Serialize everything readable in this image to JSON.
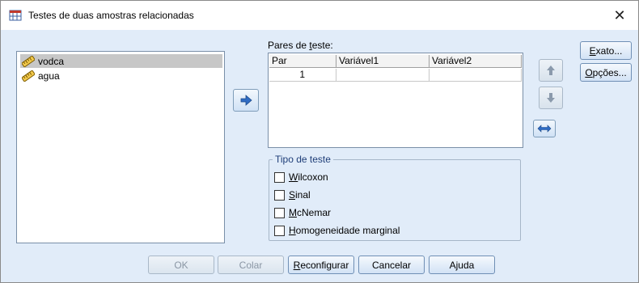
{
  "window": {
    "title": "Testes de duas amostras relacionadas",
    "close_glyph": "✕"
  },
  "variables": [
    {
      "name": "vodca",
      "icon": "scale-ruler-icon",
      "selected": true
    },
    {
      "name": "agua",
      "icon": "scale-ruler-icon",
      "selected": false
    }
  ],
  "pairs": {
    "label_prefix": "Pares de ",
    "label_accel": "t",
    "label_suffix": "este:",
    "columns": [
      "Par",
      "Variável1",
      "Variável2"
    ],
    "rows": [
      {
        "par": "1",
        "var1": "",
        "var2": ""
      }
    ]
  },
  "test_type": {
    "title": "Tipo de teste",
    "options": [
      {
        "accel": "W",
        "rest": "ilcoxon",
        "checked": false
      },
      {
        "accel": "S",
        "rest": "inal",
        "checked": false
      },
      {
        "accel": "M",
        "rest": "cNemar",
        "checked": false
      },
      {
        "accel": "H",
        "rest": "omogeneidade marginal",
        "checked": false
      }
    ]
  },
  "side_buttons": {
    "exact": {
      "accel": "E",
      "rest": "xato..."
    },
    "options": {
      "accel": "O",
      "rest": "pções..."
    }
  },
  "bottom_buttons": {
    "ok": "OK",
    "paste": "Colar",
    "reset_accel": "R",
    "reset_rest": "econfigurar",
    "cancel": "Cancelar",
    "help": "Ajuda"
  },
  "colors": {
    "dialog_bg": "#e1ecf9",
    "accent_blue": "#2f6cc4",
    "group_title": "#1f3e78"
  }
}
